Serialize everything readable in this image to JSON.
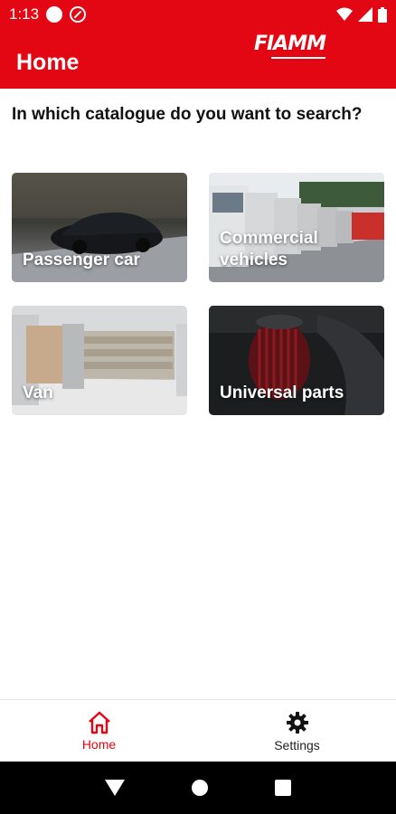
{
  "status_bar": {
    "time": "1:13"
  },
  "app_bar": {
    "title": "Home",
    "brand": "FIAMM"
  },
  "prompt": "In which catalogue do you want to search?",
  "catalogues": [
    {
      "label": "Passenger car"
    },
    {
      "label": "Commercial vehicles"
    },
    {
      "label": "Van"
    },
    {
      "label": "Universal parts"
    }
  ],
  "bottom_nav": {
    "items": [
      {
        "label": "Home",
        "icon": "home-icon",
        "active": true
      },
      {
        "label": "Settings",
        "icon": "gear-icon",
        "active": false
      }
    ]
  },
  "colors": {
    "brand_red": "#e30613",
    "text": "#111111"
  }
}
